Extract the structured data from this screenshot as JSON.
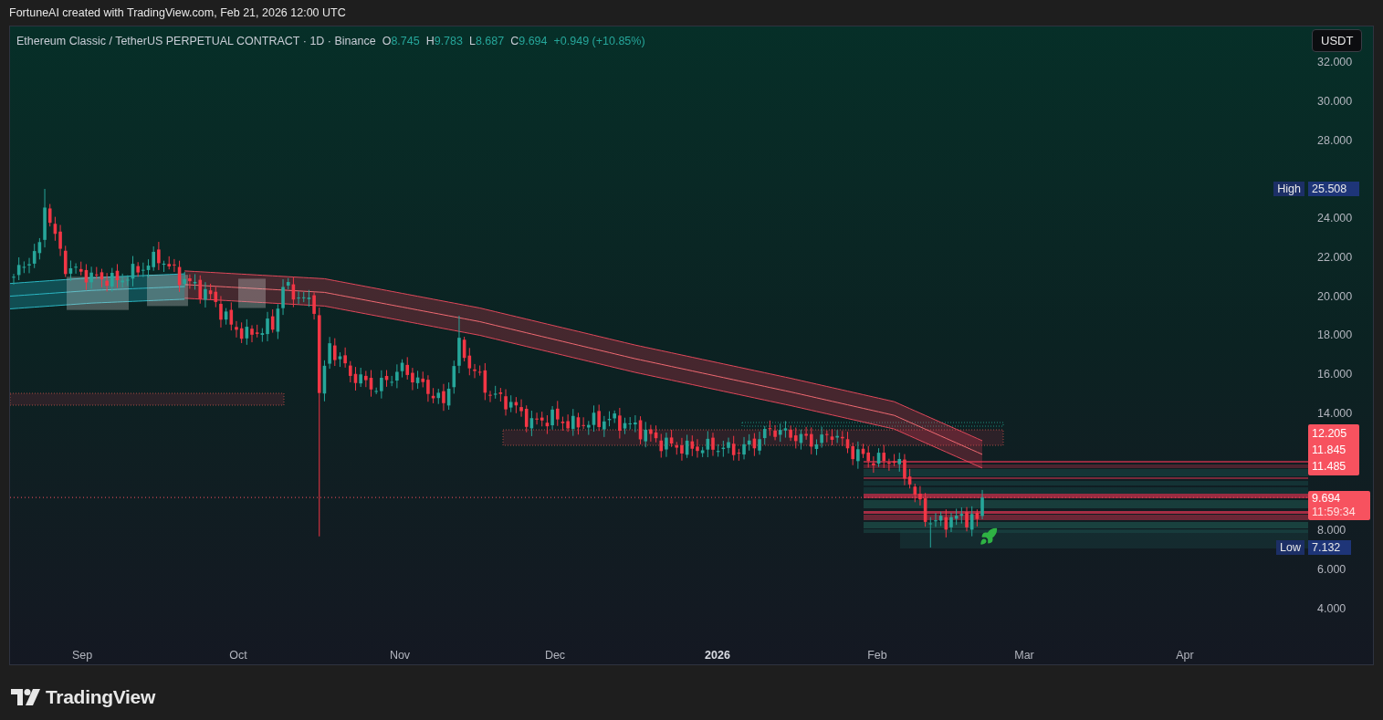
{
  "attribution": "FortuneAI created with TradingView.com, Feb 21, 2026 12:00 UTC",
  "legend": {
    "symbol": "Ethereum Classic / TetherUS PERPETUAL CONTRACT · 1D · Binance",
    "ohlc": [
      {
        "key": "O",
        "value": "8.745"
      },
      {
        "key": "H",
        "value": "9.783"
      },
      {
        "key": "L",
        "value": "8.687"
      },
      {
        "key": "C",
        "value": "9.694"
      }
    ],
    "change": "+0.949 (+10.85%)"
  },
  "currency": "USDT",
  "price_axis": [
    "32.000",
    "30.000",
    "28.000",
    "24.000",
    "22.000",
    "20.000",
    "18.000",
    "16.000",
    "14.000",
    "8.000",
    "6.000",
    "4.000"
  ],
  "markers": [
    {
      "kind": "high",
      "label": "High",
      "value": "25.508"
    },
    {
      "kind": "low",
      "label": "Low",
      "value": "7.132"
    }
  ],
  "price_tags": [
    "12.205",
    "11.845",
    "11.485"
  ],
  "last_price": {
    "value": "9.694",
    "countdown": "11:59:34"
  },
  "time_axis": [
    {
      "label": "Sep",
      "bold": false
    },
    {
      "label": "Oct",
      "bold": false
    },
    {
      "label": "Nov",
      "bold": false
    },
    {
      "label": "Dec",
      "bold": false
    },
    {
      "label": "2026",
      "bold": true
    },
    {
      "label": "Feb",
      "bold": false
    },
    {
      "label": "Mar",
      "bold": false
    },
    {
      "label": "Apr",
      "bold": false
    }
  ],
  "brand": "TradingView"
}
